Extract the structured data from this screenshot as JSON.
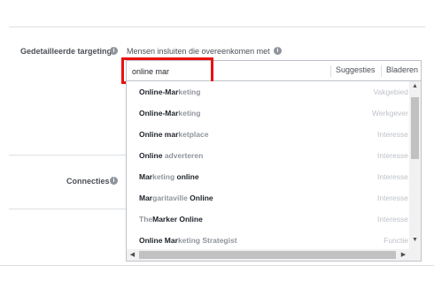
{
  "targeting": {
    "label": "Gedetailleerde targeting",
    "include_label": "Mensen insluiten die overeenkomen met",
    "info_icon_glyph": "i"
  },
  "connections": {
    "label": "Connecties",
    "info_icon_glyph": "i"
  },
  "search": {
    "value": "online mar",
    "suggestions_label": "Suggesties",
    "browse_label": "Bladeren"
  },
  "dropdown": {
    "items": [
      {
        "match": "Online-Mar",
        "rest": "",
        "tail": "keting",
        "category": "Vakgebied"
      },
      {
        "match": "Online-Mar",
        "rest": "",
        "tail": "keting",
        "category": "Werkgever"
      },
      {
        "match": "Online mar",
        "rest": "",
        "tail": "ketplace",
        "category": "Interesse"
      },
      {
        "match": "Online",
        "rest": " adverteren",
        "tail": "",
        "category": "Interesse"
      },
      {
        "match": "Mar",
        "rest": "keting",
        "tail": " online",
        "category": "Interesse"
      },
      {
        "match": "Mar",
        "rest": "garitaville",
        "tail": " Online",
        "category": "Interesse"
      },
      {
        "match": "",
        "rest": "The",
        "tail": "Marker Online",
        "category": "Interesse"
      },
      {
        "match": "Online Mar",
        "rest": "keting Strategist",
        "tail": "",
        "category": "Functie"
      }
    ]
  },
  "colors": {
    "highlight_box": "#e8110f",
    "border": "#bec2c9"
  }
}
